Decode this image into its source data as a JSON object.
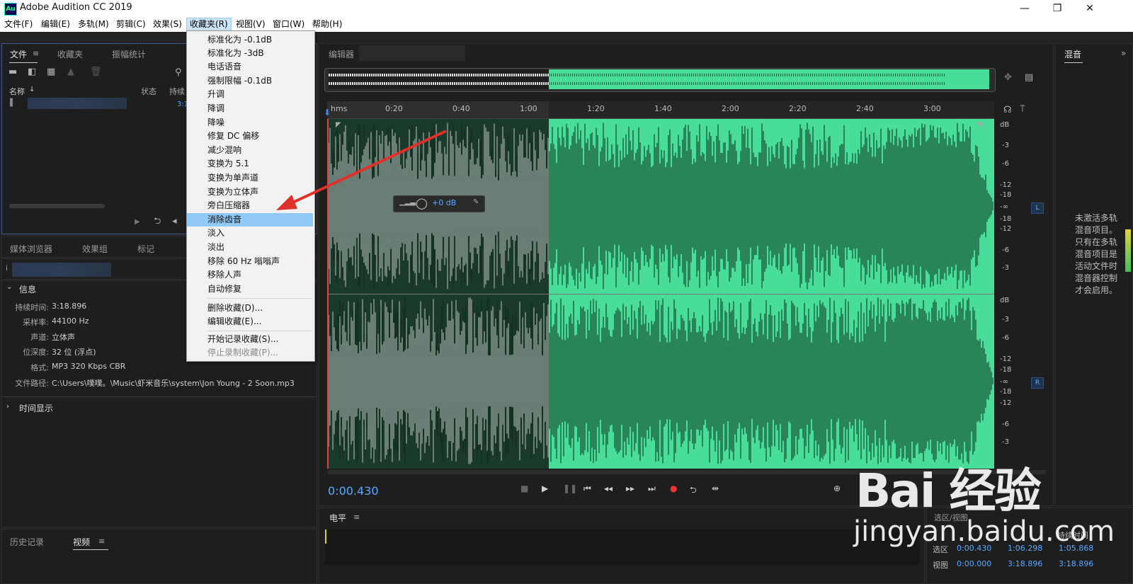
{
  "window": {
    "title": "Adobe Audition CC 2019",
    "app_icon": "Au",
    "minimize": "—",
    "maximize": "❐",
    "close": "✕"
  },
  "menubar": [
    "文件(F)",
    "编辑(E)",
    "多轨(M)",
    "剪辑(C)",
    "效果(S)",
    "收藏夹(R)",
    "视图(V)",
    "窗口(W)",
    "帮助(H)"
  ],
  "favorites_menu": {
    "items": [
      "标准化为 -0.1dB",
      "标准化为 -3dB",
      "电话语音",
      "强制限幅 -0.1dB",
      "升调",
      "降调",
      "降噪",
      "修复 DC 偏移",
      "减少混响",
      "变换为 5.1",
      "变换为单声道",
      "变换为立体声",
      "旁白压缩器",
      "消除齿音",
      "淡入",
      "淡出",
      "移除 60 Hz 嗡嗡声",
      "移除人声",
      "自动修复"
    ],
    "highlighted": "消除齿音",
    "manage": [
      "删除收藏(D)...",
      "编辑收藏(E)..."
    ],
    "record": [
      "开始记录收藏(S)...",
      "停止录制收藏(P)..."
    ]
  },
  "files_panel": {
    "tabs": [
      "文件",
      "收藏夹",
      "振幅统计"
    ],
    "col_name": "名称",
    "col_status": "状态",
    "col_duration": "持续",
    "row_duration": "3:1"
  },
  "media_panel": {
    "tabs": [
      "媒体浏览器",
      "效果组",
      "标记"
    ]
  },
  "info": {
    "section": "信息",
    "duration_label": "持续时间:",
    "duration": "3:18.896",
    "samplerate_label": "采样率:",
    "samplerate": "44100 Hz",
    "channels_label": "声道:",
    "channels": "立体声",
    "bitdepth_label": "位深度:",
    "bitdepth": "32 位 (浮点)",
    "format_label": "格式:",
    "format": "MP3 320 Kbps CBR",
    "path_label": "文件路径:",
    "path": "C:\\Users\\噗噗。\\Music\\虾米音乐\\system\\Jon Young - 2 Soon.mp3",
    "time_display": "时间显示"
  },
  "bottom_left_tabs": [
    "历史记录",
    "视频"
  ],
  "editor": {
    "tab_label": "编辑器",
    "ruler": [
      "hms",
      "0:20",
      "0:40",
      "1:00",
      "1:20",
      "1:40",
      "2:00",
      "2:20",
      "2:40",
      "3:00"
    ],
    "db_scale_L": [
      "dB",
      "-3",
      "-6",
      "-12",
      "-18",
      "-∞",
      "-18",
      "-12",
      "-6",
      "-3"
    ],
    "db_scale_R": [
      "dB",
      "-3",
      "-6",
      "-12",
      "-18",
      "-∞",
      "-18",
      "-12",
      "-6",
      "-3"
    ],
    "hud_gain": "+0 dB",
    "channel_L": "L",
    "channel_R": "R",
    "current_time": "0:00.430"
  },
  "levels_panel": {
    "title": "电平"
  },
  "mixer_panel": {
    "title": "混音",
    "note": "未激活多轨混音项目。只有在多轨混音项目是活动文件时混音器控制才会启用。"
  },
  "selection_panel": {
    "title": "选区/视图",
    "col_duration": "持续时间",
    "sel_label": "选区",
    "sel_start": "0:00.430",
    "sel_end": "1:06.298",
    "sel_dur": "1:05.868",
    "view_label": "视图",
    "view_start": "0:00.000",
    "view_end": "3:18.896",
    "view_dur": "3:18.896"
  },
  "watermark": {
    "logo": "Bai 经验",
    "url": "jingyan.baidu.com"
  },
  "colors": {
    "waveform": "#48dd99",
    "selection": "#1a3a2c",
    "menu_highlight": "#91c9f7",
    "time_blue": "#5aa8ff"
  }
}
